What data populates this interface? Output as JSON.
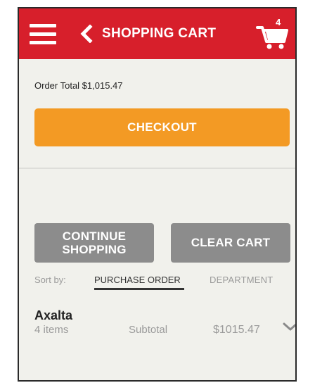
{
  "header": {
    "title": "SHOPPING CART",
    "cart_count": "4",
    "bg_color": "#d71f2b"
  },
  "order": {
    "total_text": "Order Total $1,015.47",
    "checkout_label": "CHECKOUT",
    "checkout_color": "#f39a24"
  },
  "actions": {
    "continue_line1": "CONTINUE",
    "continue_line2": "SHOPPING",
    "clear_label": "CLEAR CART"
  },
  "sort": {
    "label": "Sort by:",
    "option_active": "PURCHASE ORDER",
    "option_other": "DEPARTMENT"
  },
  "cart_group": {
    "brand": "Axalta",
    "items": "4 items",
    "subtotal_label": "Subtotal",
    "subtotal_value": "$1015.47"
  },
  "icons": [
    "menu-icon",
    "back-chevron-icon",
    "cart-icon",
    "chevron-down-icon"
  ]
}
